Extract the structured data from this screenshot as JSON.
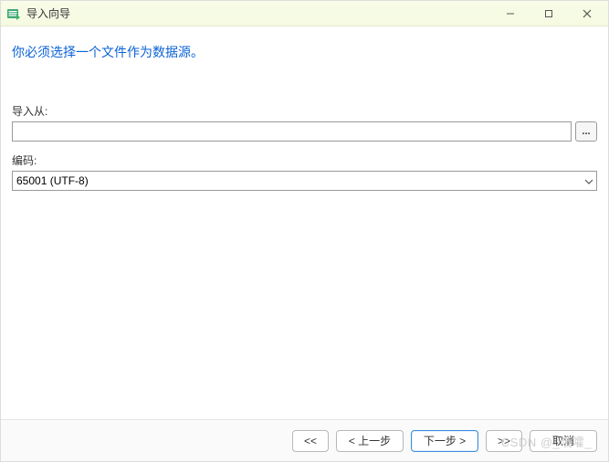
{
  "titlebar": {
    "title": "导入向导"
  },
  "instruction": "你必须选择一个文件作为数据源。",
  "fields": {
    "import_from_label": "导入从:",
    "import_from_value": "",
    "browse_label": "...",
    "encoding_label": "编码:",
    "encoding_value": "65001 (UTF-8)"
  },
  "footer": {
    "first": "<<",
    "prev": "< 上一步",
    "next": "下一步 >",
    "last": ">>",
    "cancel": "取消"
  },
  "watermark": "CSDN @_哦嚯_"
}
